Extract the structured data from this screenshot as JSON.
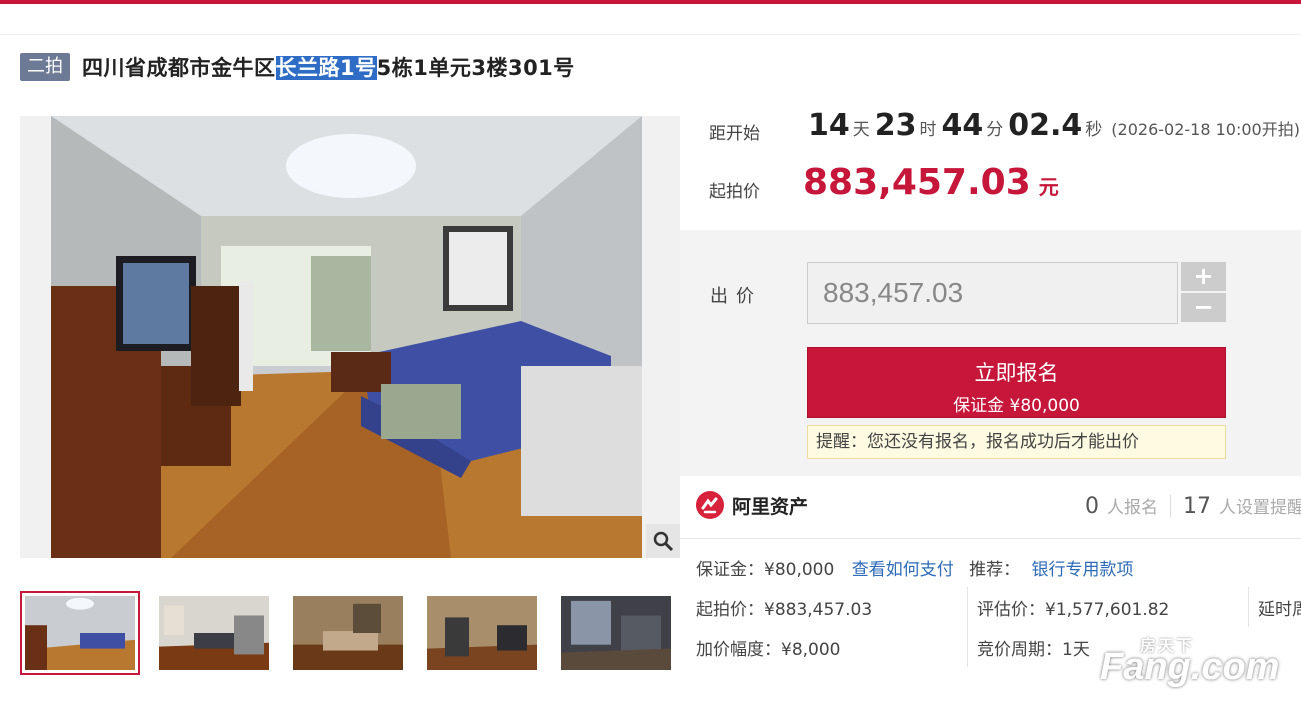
{
  "header": {
    "badge": "二拍",
    "title_pre": "四川省成都市金牛区",
    "title_highlight": "长兰路1号",
    "title_post": "5栋1单元3楼301号"
  },
  "countdown": {
    "label": "距开始",
    "days": "14",
    "days_unit": "天",
    "hours": "23",
    "hours_unit": "时",
    "minutes": "44",
    "minutes_unit": "分",
    "seconds": "02.4",
    "seconds_unit": "秒",
    "start_note": "(2026-02-18 10:00开拍)"
  },
  "start_price": {
    "label": "起拍价",
    "value": "883,457.03",
    "unit": "元"
  },
  "bid": {
    "label": "出价",
    "value": "883,457.03",
    "plus": "+",
    "minus": "−",
    "apply_label": "立即报名",
    "deposit_label": "保证金 ¥80,000",
    "notice": "提醒：您还没有报名，报名成功后才能出价"
  },
  "brand": {
    "name": "阿里资产"
  },
  "stats": {
    "registered": "0",
    "registered_label": "人报名",
    "reminders": "17",
    "reminders_label": "人设置提醒"
  },
  "details": {
    "deposit": "保证金：¥80,000",
    "how_to_pay": "查看如何支付",
    "recommend_label": "推荐：",
    "recommend_link": "银行专用款项",
    "start_price": "起拍价：¥883,457.03",
    "appraisal": "评估价：¥1,577,601.82",
    "delay": "延时周",
    "increment": "加价幅度：¥8,000",
    "cycle": "竞价周期：1天"
  },
  "watermark": {
    "top": "房天下",
    "main": "Fang.com"
  },
  "colors": {
    "accent": "#c6163a",
    "badge": "#6c7a96",
    "link": "#2d6bb8",
    "highlight": "#2f6cc6"
  },
  "icons": {
    "zoom": "magnifier-icon",
    "brand": "ali-assets-logo-icon"
  }
}
